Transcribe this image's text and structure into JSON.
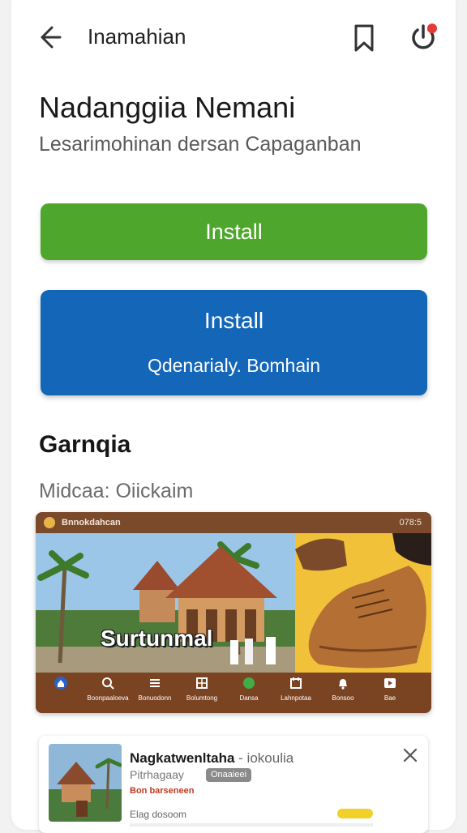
{
  "appbar": {
    "title": "Inamahian",
    "back_icon": "arrow-left-icon",
    "bookmark_icon": "bookmark-icon",
    "power_icon": "power-icon",
    "notification_dot_color": "#e53935"
  },
  "header": {
    "title": "Nadanggiia Nemani",
    "subtitle": "Lesarimohinan dersan Capaganban"
  },
  "buttons": {
    "primary": {
      "label": "Install",
      "color": "#4fa62d"
    },
    "secondary": {
      "label": "Install",
      "sublabel": "Qdenarialy. Bomhain",
      "color": "#1466b8"
    }
  },
  "gallery": {
    "title": "Garnqia",
    "subtitle": "Midcaa: Oiickaim",
    "screenshot": {
      "status_left": "Bnnokdahcan",
      "status_right": "078:5",
      "caption": "Surtunmal",
      "tabs": [
        {
          "icon": "home-icon",
          "label": ""
        },
        {
          "icon": "search-icon",
          "label": "Boonpaaloeva"
        },
        {
          "icon": "list-icon",
          "label": "Bonuodonn"
        },
        {
          "icon": "grid-icon",
          "label": "Bolumtong"
        },
        {
          "icon": "circle-icon",
          "label": "Dansa"
        },
        {
          "icon": "calendar-icon",
          "label": "Lahnpotaa"
        },
        {
          "icon": "bell-icon",
          "label": "Bonsoo"
        },
        {
          "icon": "play-icon",
          "label": "Bae"
        }
      ]
    }
  },
  "list_item": {
    "title": "Nagkatwenltaha",
    "title_suffix": "- iokoulia",
    "subtitle": "Pitrhagaay",
    "badge": "Onaaieei",
    "link": "Bon barseneen",
    "meta": "Elag dosoom",
    "close_icon": "close-icon",
    "accent_color": "#f1d02a"
  }
}
